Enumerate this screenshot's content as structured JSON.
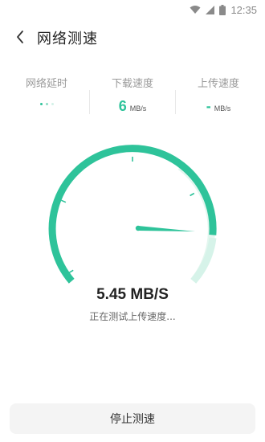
{
  "status_bar": {
    "time": "12:35",
    "icons": [
      "wifi-icon",
      "cellular-signal-icon",
      "battery-icon"
    ]
  },
  "header": {
    "back_icon": "chevron-left-icon",
    "title": "网络测速"
  },
  "stats": {
    "latency": {
      "label": "网络延时",
      "state": "loading"
    },
    "download": {
      "label": "下载速度",
      "value": "6",
      "unit": "MB/s"
    },
    "upload": {
      "label": "上传速度",
      "value": "-",
      "unit": "MB/s"
    }
  },
  "gauge": {
    "current_speed": "5.45 MB/S",
    "status": "正在测试上传速度...",
    "colors": {
      "accent": "#2ec39a",
      "track": "#e3f6ef"
    }
  },
  "actions": {
    "stop_label": "停止测速"
  }
}
